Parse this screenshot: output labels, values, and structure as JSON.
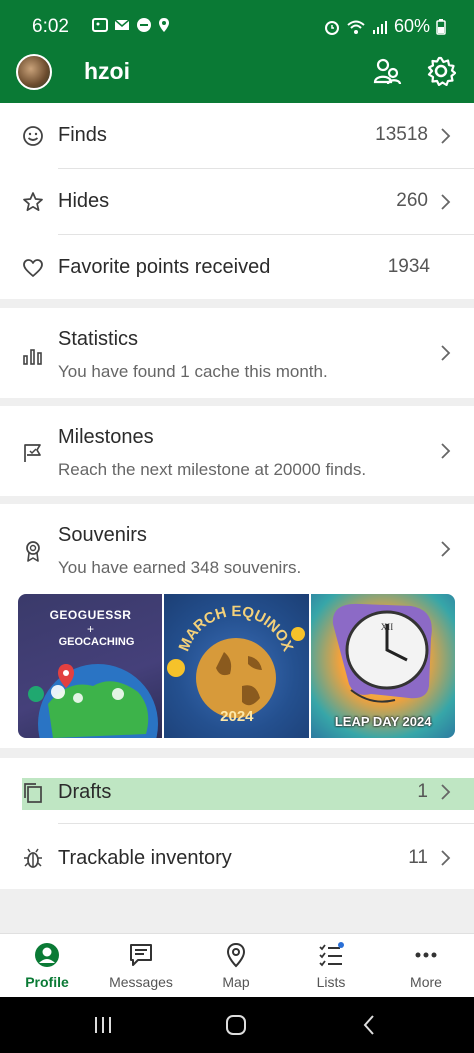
{
  "status": {
    "time": "6:02",
    "battery": "60%"
  },
  "header": {
    "username": "hzoi"
  },
  "stats": [
    {
      "label": "Finds",
      "value": "13518",
      "icon": "smile-icon"
    },
    {
      "label": "Hides",
      "value": "260",
      "icon": "star-icon"
    },
    {
      "label": "Favorite points received",
      "value": "1934",
      "icon": "heart-icon"
    }
  ],
  "statistics": {
    "title": "Statistics",
    "subtitle": "You have found 1 cache this month."
  },
  "milestones": {
    "title": "Milestones",
    "subtitle": "Reach the next milestone at 20000 finds."
  },
  "souvenirs": {
    "title": "Souvenirs",
    "subtitle": "You have earned 348 souvenirs.",
    "tiles": [
      {
        "line1": "GEOGUESSR",
        "line2": "+",
        "line3": "GEOCACHING"
      },
      {
        "arc": "MARCH EQUINOX",
        "year": "2024"
      },
      {
        "caption": "LEAP DAY 2024"
      }
    ]
  },
  "drafts": {
    "label": "Drafts",
    "value": "1"
  },
  "trackables": {
    "label": "Trackable inventory",
    "value": "11"
  },
  "nav": [
    {
      "label": "Profile",
      "icon": "profile-icon"
    },
    {
      "label": "Messages",
      "icon": "messages-icon"
    },
    {
      "label": "Map",
      "icon": "map-pin-icon"
    },
    {
      "label": "Lists",
      "icon": "lists-icon"
    },
    {
      "label": "More",
      "icon": "more-icon"
    }
  ],
  "colors": {
    "brand": "#0a7a35",
    "highlight": "#bfe6c3"
  }
}
